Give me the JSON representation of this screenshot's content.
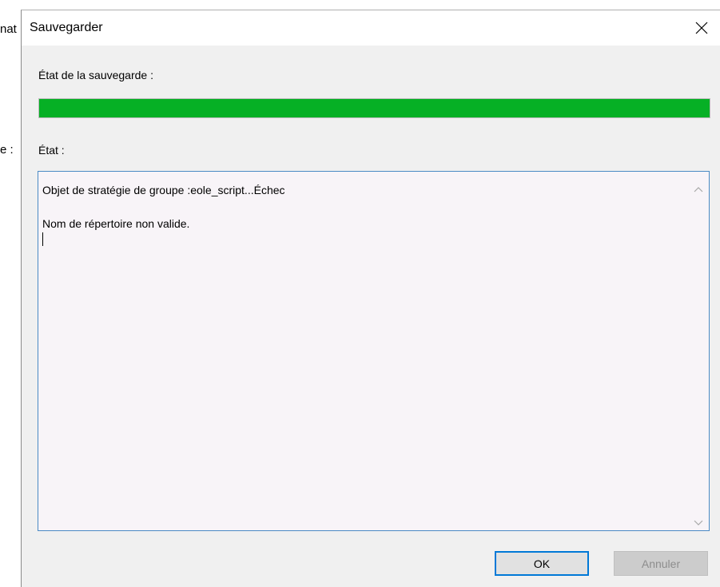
{
  "background": {
    "fragment_top": "nat",
    "fragment_mid": "e :"
  },
  "dialog": {
    "title": "Sauvegarder",
    "close_icon": "close-icon"
  },
  "backup": {
    "label": "État de la sauvegarde :",
    "progress": 1.0,
    "progress_color": "#06b025"
  },
  "status": {
    "label": "État :",
    "lines": [
      "Objet de stratégie de groupe :eole_script...Échec",
      "Nom de répertoire non valide."
    ]
  },
  "buttons": {
    "ok": "OK",
    "cancel": "Annuler"
  },
  "colors": {
    "accent": "#0078d7",
    "focus_border": "#4a8ac4"
  }
}
